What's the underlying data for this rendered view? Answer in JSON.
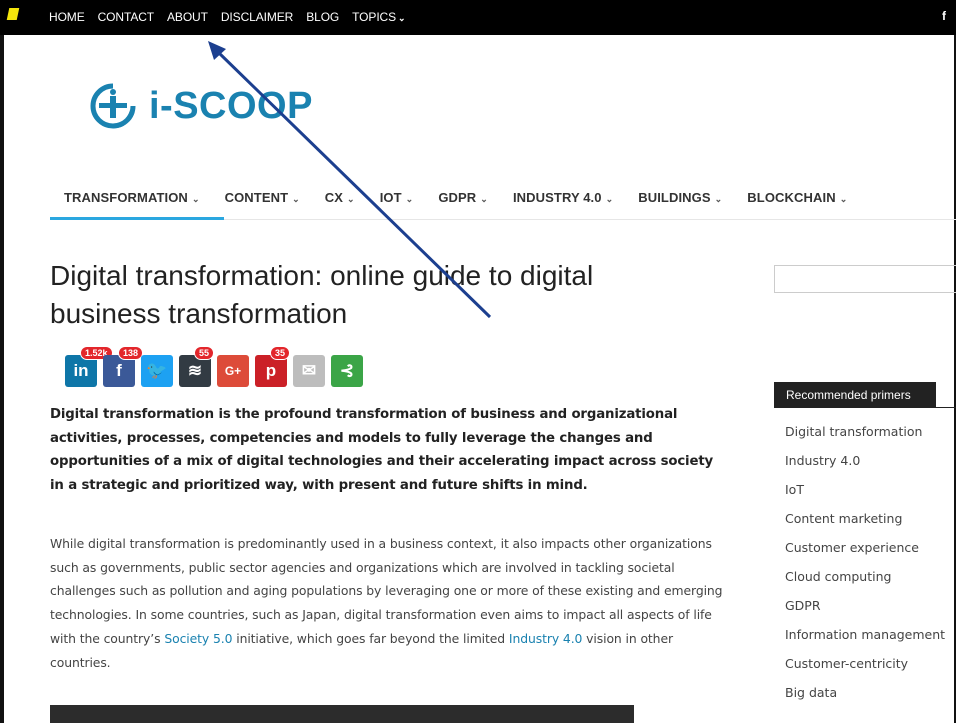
{
  "topbar": {
    "items": [
      "HOME",
      "CONTACT",
      "ABOUT",
      "DISCLAIMER",
      "BLOG",
      "TOPICS"
    ],
    "topics_chevron": "⌄",
    "facebook": "f"
  },
  "logo": {
    "text": "i-SCOOP"
  },
  "mainnav": {
    "items": [
      "TRANSFORMATION",
      "CONTENT",
      "CX",
      "IOT",
      "GDPR",
      "INDUSTRY 4.0",
      "BUILDINGS",
      "BLOCKCHAIN"
    ],
    "chevron": "⌄"
  },
  "article": {
    "title": "Digital transformation: online guide to digital business transformation",
    "share": [
      {
        "name": "linkedin",
        "glyph": "in",
        "color": "#0e76a8",
        "count": "1.52k"
      },
      {
        "name": "facebook",
        "glyph": "f",
        "color": "#3b5998",
        "count": "138"
      },
      {
        "name": "twitter",
        "glyph": "🐦",
        "color": "#1da1f2",
        "count": ""
      },
      {
        "name": "buffer",
        "glyph": "≋",
        "color": "#323b43",
        "count": "55"
      },
      {
        "name": "google-plus",
        "glyph": "G+",
        "color": "#dd4b39",
        "count": ""
      },
      {
        "name": "pinterest",
        "glyph": "p",
        "color": "#cb2027",
        "count": "35"
      },
      {
        "name": "email",
        "glyph": "✉",
        "color": "#bdbdbd",
        "count": ""
      },
      {
        "name": "sharethis",
        "glyph": "⊰",
        "color": "#3ba547",
        "count": ""
      }
    ],
    "lead": "Digital transformation is the profound transformation of business and organizational activities, processes, competencies and models to fully leverage the changes and opportunities of a mix of digital technologies and their accelerating impact across society in a strategic and prioritized way, with present and future shifts in mind.",
    "body_part1": "While digital transformation is predominantly used in a business context, it also impacts other organizations such as governments, public sector agencies and organizations which are involved in tackling societal challenges such as pollution and aging populations by leveraging one or more of these existing and emerging technologies. In some countries, such as Japan, digital transformation even aims to impact all aspects of life with the country’s ",
    "body_link1": "Society 5.0",
    "body_part2": " initiative, which goes far beyond the limited ",
    "body_link2": "Industry 4.0",
    "body_part3": " vision in other countries."
  },
  "sidebar": {
    "widget_title": "Recommended primers",
    "primers": [
      "Digital transformation",
      "Industry 4.0",
      "IoT",
      "Content marketing",
      "Customer experience",
      "Cloud computing",
      "GDPR",
      "Information management",
      "Customer-centricity",
      "Big data"
    ]
  },
  "colors": {
    "accent": "#1a82b0",
    "nav_underline": "#2aa7e0",
    "arrow": "#1c3f8f"
  }
}
